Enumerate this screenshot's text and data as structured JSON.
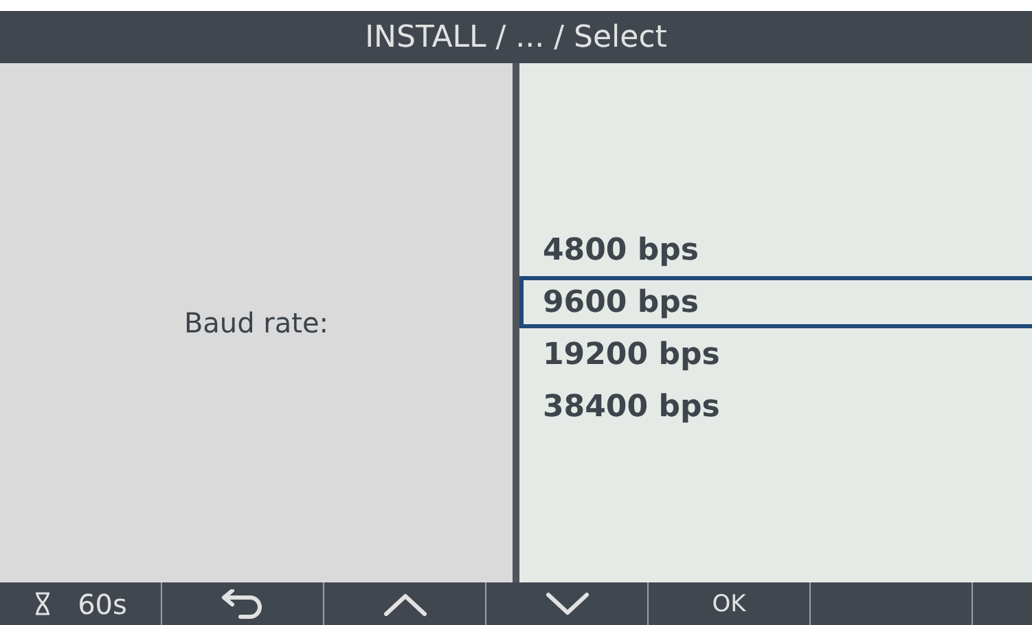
{
  "header": {
    "title": "INSTALL / ... / Select"
  },
  "field": {
    "label": "Baud rate:"
  },
  "options": [
    {
      "label": "4800 bps",
      "selected": false
    },
    {
      "label": "9600 bps",
      "selected": true
    },
    {
      "label": "19200 bps",
      "selected": false
    },
    {
      "label": "38400 bps",
      "selected": false
    }
  ],
  "footer": [
    {
      "kind": "timer",
      "label": "60s"
    },
    {
      "kind": "back"
    },
    {
      "kind": "up"
    },
    {
      "kind": "down"
    },
    {
      "kind": "text",
      "label": "OK"
    },
    {
      "kind": "empty"
    }
  ]
}
